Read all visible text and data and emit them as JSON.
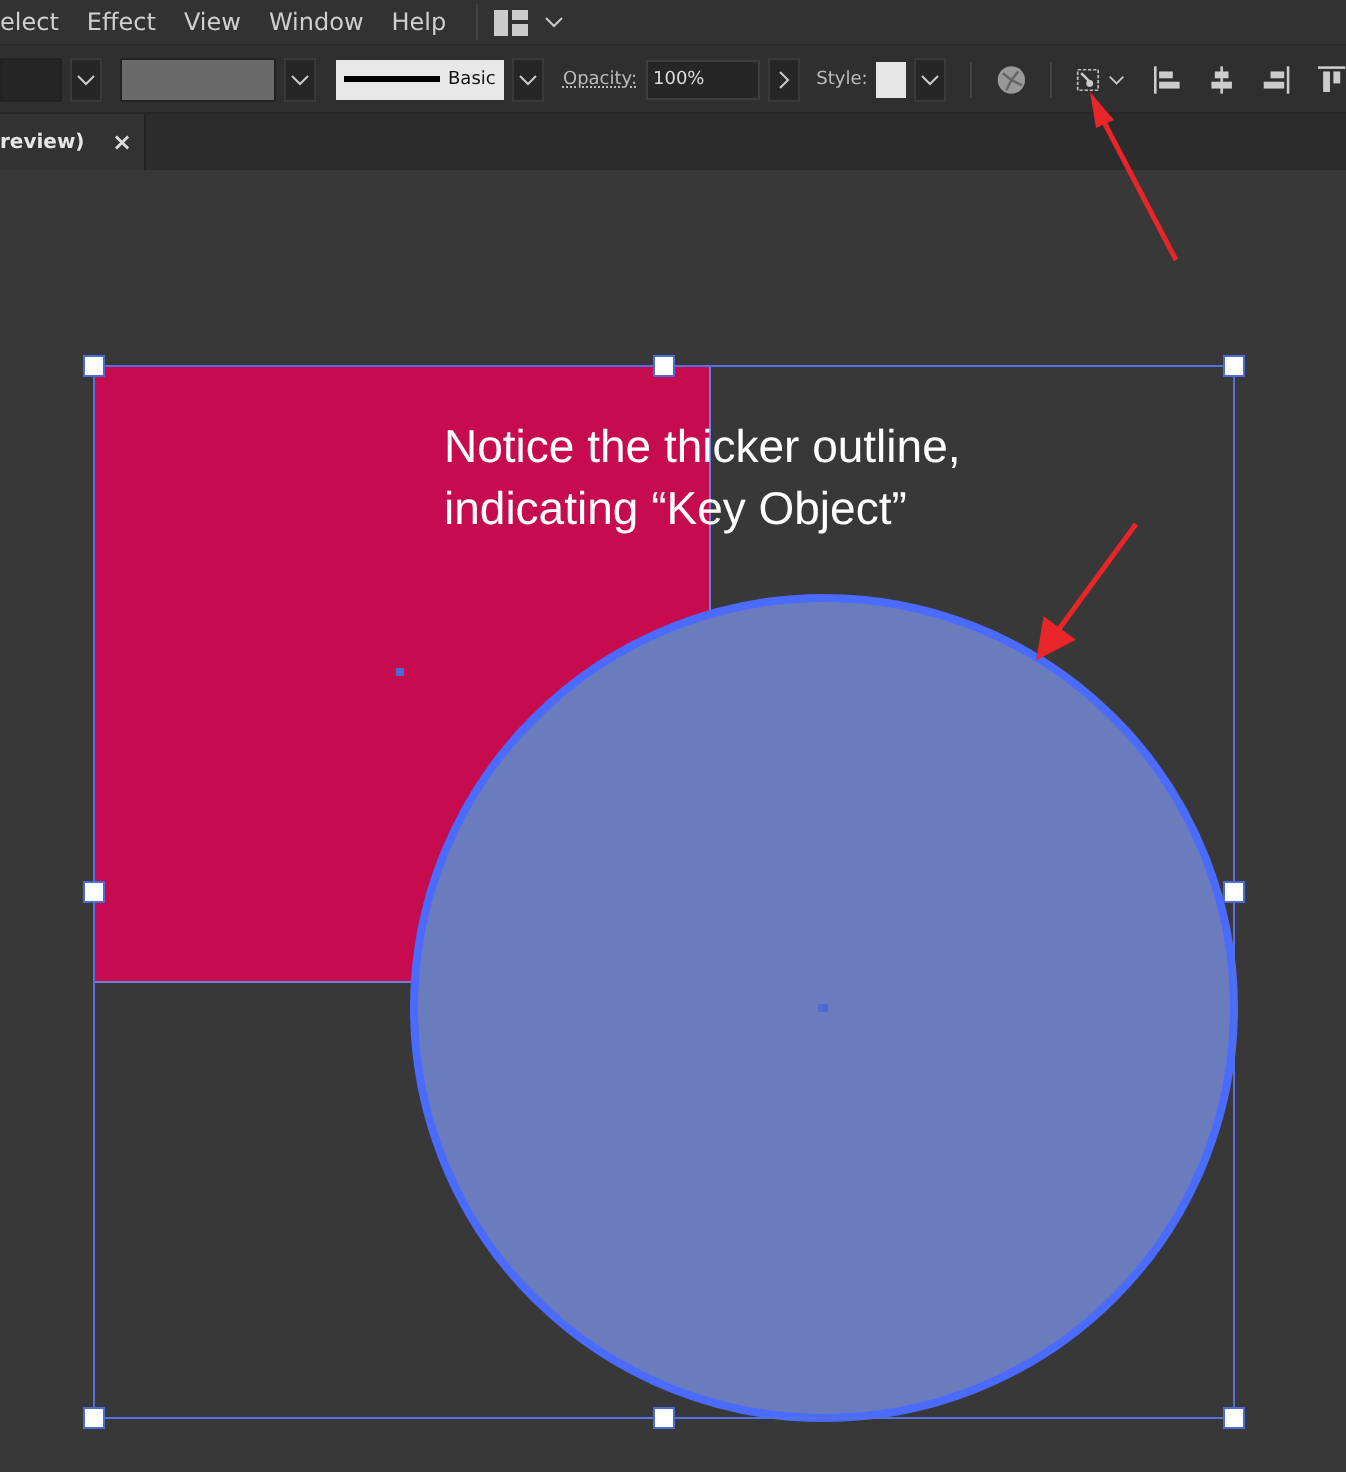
{
  "menu": [
    "elect",
    "Effect",
    "View",
    "Window",
    "Help"
  ],
  "control_bar": {
    "stroke_style": "Basic",
    "opacity_label": "Opacity:",
    "opacity_value": "100%",
    "style_label": "Style:"
  },
  "tab": {
    "title": "review)",
    "close": "×"
  },
  "annotation": "Notice the thicker outline, indicating “Key Object”"
}
